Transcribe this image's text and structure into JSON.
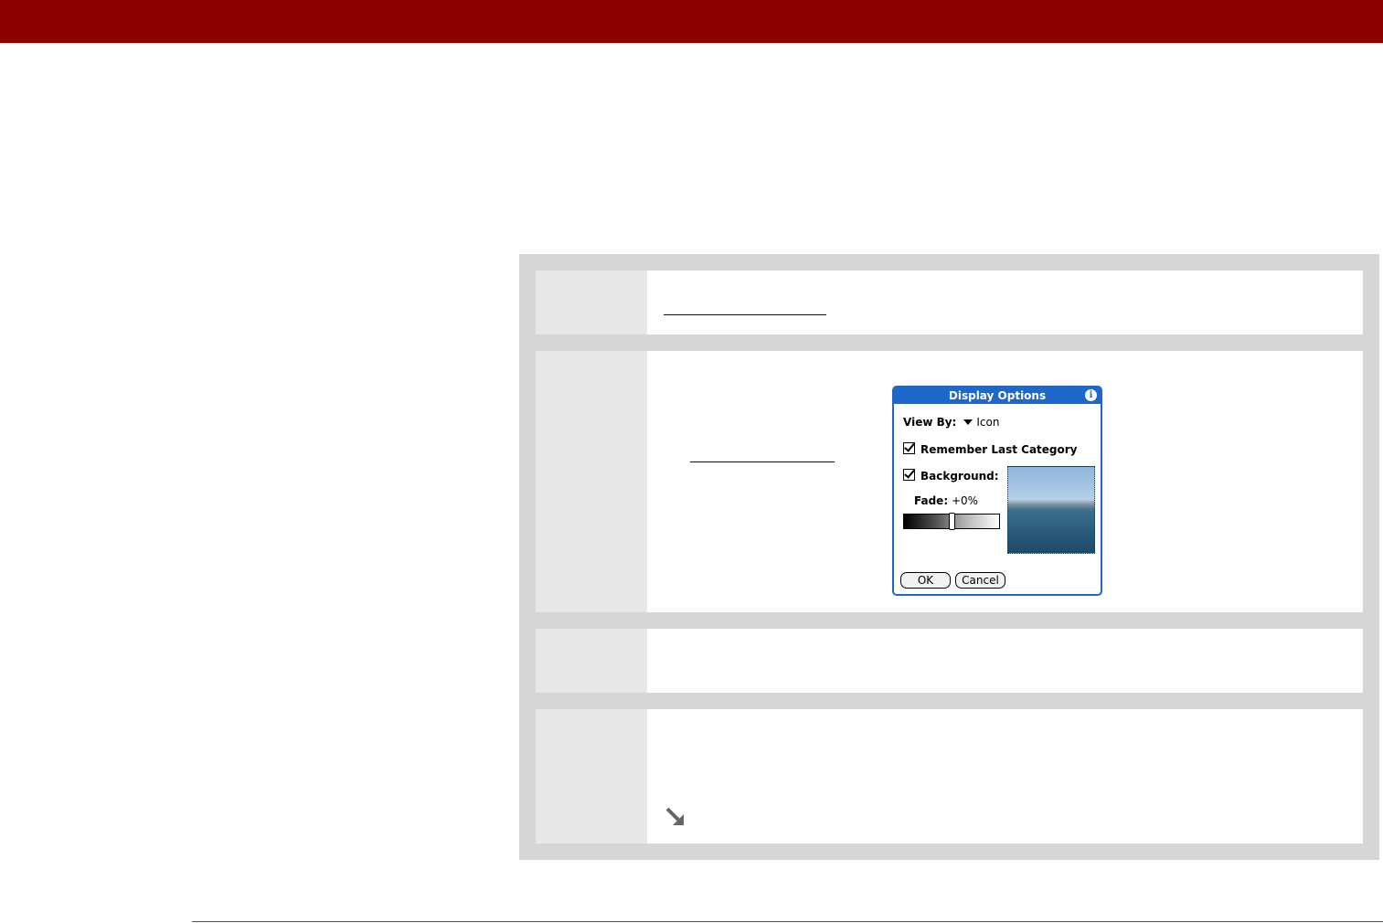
{
  "colors": {
    "header_bar": "#8b0000",
    "panel": "#d6d6d6",
    "dialog_accent": "#1f68c9"
  },
  "dialog": {
    "title": "Display Options",
    "info_icon": "info-icon",
    "view_by_label": "View By:",
    "view_by_value": "Icon",
    "remember_label": "Remember Last Category",
    "remember_checked": true,
    "background_label": "Background:",
    "background_checked": true,
    "fade_label": "Fade:",
    "fade_value": "+0%",
    "fade_level_fraction": 0.5,
    "ok_label": "OK",
    "cancel_label": "Cancel"
  },
  "step4": {
    "icon": "arrow-down-right-icon"
  }
}
